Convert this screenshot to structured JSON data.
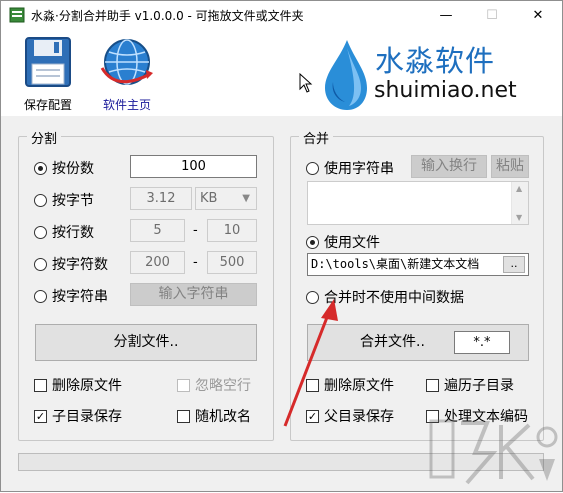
{
  "window": {
    "title": "水淼·分割合并助手 v1.0.0.0 - 可拖放文件或文件夹",
    "min_symbol": "—",
    "max_symbol": "☐",
    "close_symbol": "✕"
  },
  "toolbar": {
    "save_label": "保存配置",
    "home_label": "软件主页"
  },
  "brand": {
    "name": "水淼软件",
    "domain": "shuimiao.net"
  },
  "split": {
    "title": "分割",
    "by_count_label": "按份数",
    "by_count_value": "100",
    "by_bytes_label": "按字节",
    "by_bytes_value": "3.12",
    "by_bytes_unit": "KB",
    "by_lines_label": "按行数",
    "by_lines_from": "5",
    "by_lines_to": "10",
    "by_chars_label": "按字符数",
    "by_chars_from": "200",
    "by_chars_to": "500",
    "by_string_label": "按字符串",
    "input_string_button": "输入字符串",
    "range_dash": "-",
    "split_button": "分割文件..",
    "delete_source_label": "删除原文件",
    "ignore_blank_label": "忽略空行",
    "subdir_save_label": "子目录保存",
    "random_rename_label": "随机改名"
  },
  "merge": {
    "title": "合并",
    "use_string_label": "使用字符串",
    "input_newline_button": "输入换行",
    "paste_button": "粘贴",
    "use_file_label": "使用文件",
    "file_path_value": "D:\\tools\\桌面\\新建文本文档",
    "browse_button": "..",
    "no_intermediate_label": "合并时不使用中间数据",
    "merge_button": "合并文件..",
    "pattern_value": "*.*",
    "delete_source_label": "删除原文件",
    "traverse_subdirs_label": "遍历子目录",
    "parent_dir_save_label": "父目录保存",
    "text_encoding_label": "处理文本编码"
  },
  "colors": {
    "accent_blue": "#1e6fbf",
    "annotation_red": "#d62a2a"
  },
  "icons": {
    "save": "floppy-disk-icon",
    "home": "globe-icon",
    "logo": "water-drop-logo-icon"
  }
}
